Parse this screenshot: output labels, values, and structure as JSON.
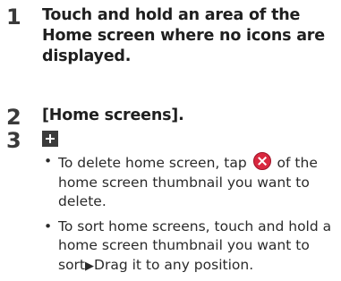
{
  "steps": [
    {
      "number": "1",
      "text": "Touch and hold an area of the Home screen where no icons are displayed."
    },
    {
      "number": "2",
      "text": "[Home screens]."
    },
    {
      "number": "3",
      "icon": "add-icon"
    }
  ],
  "bullets": {
    "marker": "•",
    "delete_part1": "To delete home screen, tap",
    "delete_icon": "delete-icon",
    "delete_part2": "of the home screen thumbnail you want to delete.",
    "sort_part1": "To sort home screens, touch and hold a home screen thumbnail you want to sort",
    "sort_arrow": "▶",
    "sort_part2": "Drag it to any position."
  },
  "colors": {
    "delete_icon_red": "#d9283f",
    "add_icon_bg": "#3b3b3b"
  }
}
